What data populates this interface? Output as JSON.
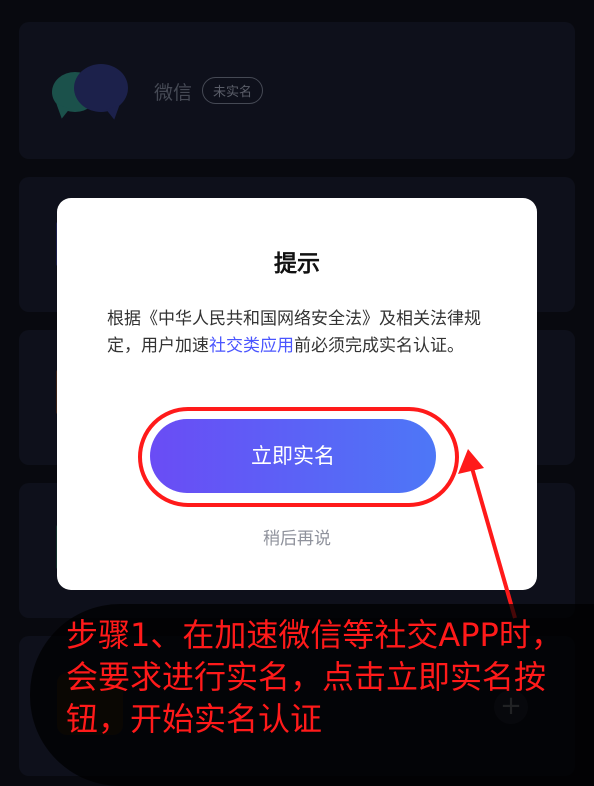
{
  "app_card": {
    "name": "微信",
    "badge": "未实名"
  },
  "dialog": {
    "title": "提示",
    "body_pre": "根据《中华人民共和国网络安全法》及相关法律规定，用户加速",
    "body_link": "社交类应用",
    "body_post": "前必须完成实名认证。",
    "primary_button": "立即实名",
    "secondary_button": "稍后再说"
  },
  "bottom_bar": {
    "add_symbol": "+"
  },
  "annotation": {
    "text": "步骤1、在加速微信等社交APP时，会要求进行实名，点击立即实名按钮，开始实名认证",
    "color": "#ff1a1a"
  },
  "colors": {
    "background": "#0d0f18",
    "card": "#161a2a",
    "button_gradient_start": "#6a4cf5",
    "button_gradient_end": "#4d77f7",
    "link": "#4a55ff"
  }
}
